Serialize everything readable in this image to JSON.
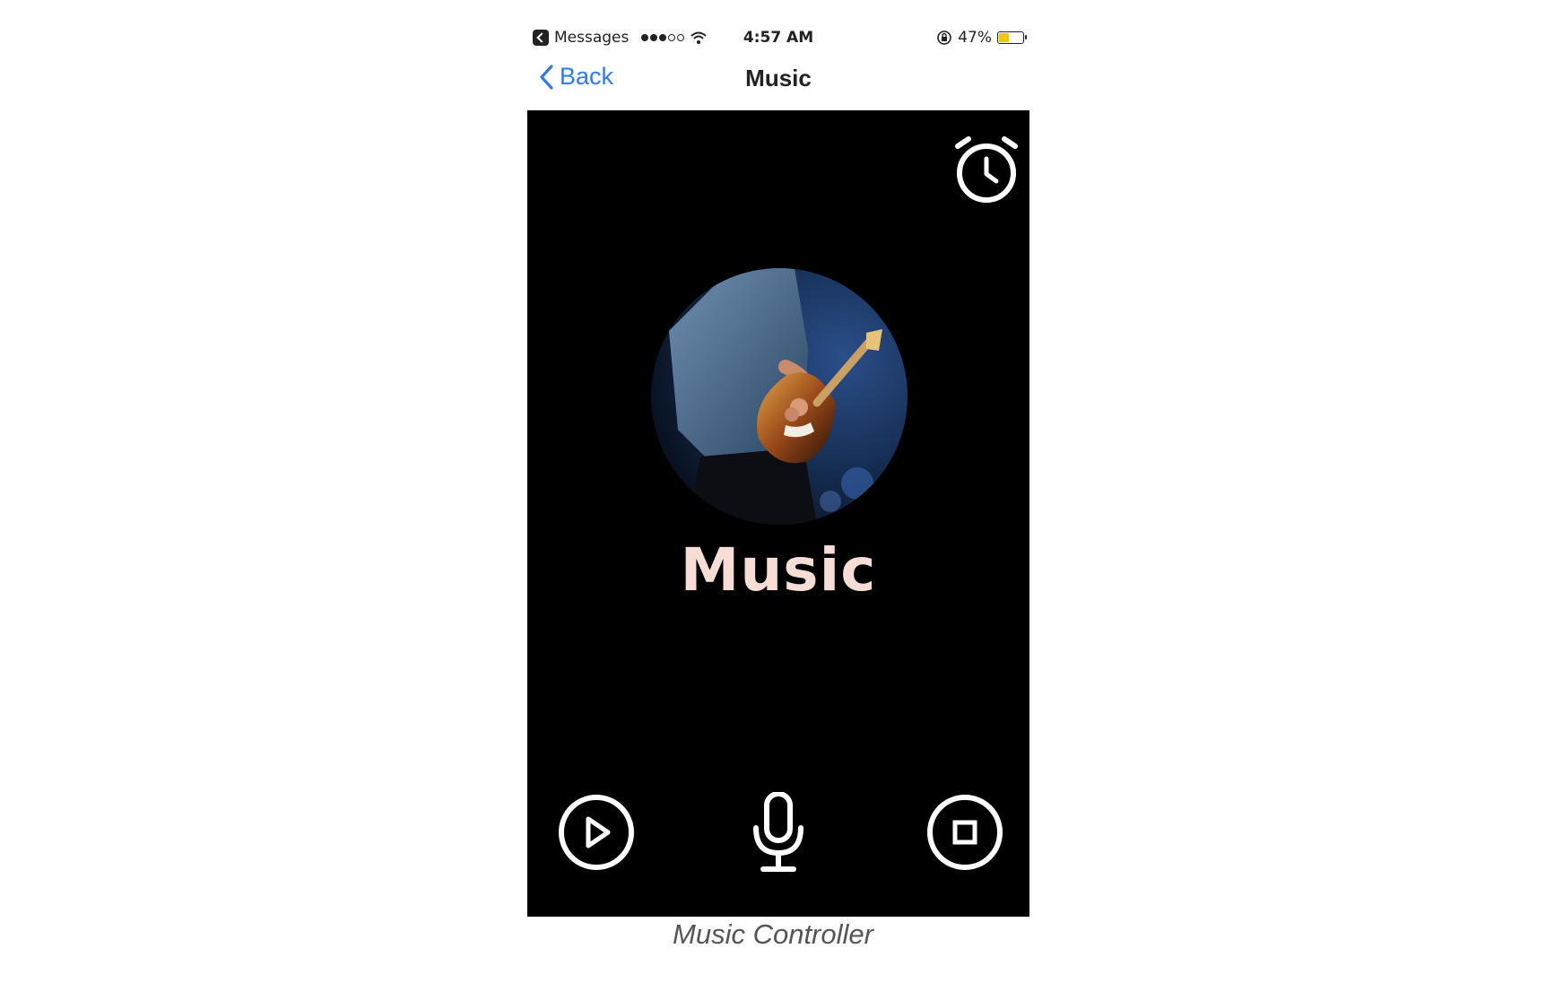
{
  "status_bar": {
    "back_app": "Messages",
    "time": "4:57 AM",
    "battery_label": "47%",
    "battery_level": 0.47,
    "battery_color": "#f0c419",
    "signal_bars_filled": 3,
    "signal_bars_total": 5
  },
  "nav": {
    "back_label": "Back",
    "title": "Music"
  },
  "content": {
    "music_label": "Music",
    "background_color": "#000000",
    "label_color": "#f6ddd6"
  },
  "icons": {
    "alarm": "alarm-clock-icon",
    "play": "play-icon",
    "mic": "microphone-icon",
    "stop": "stop-icon"
  },
  "caption": "Music Controller"
}
